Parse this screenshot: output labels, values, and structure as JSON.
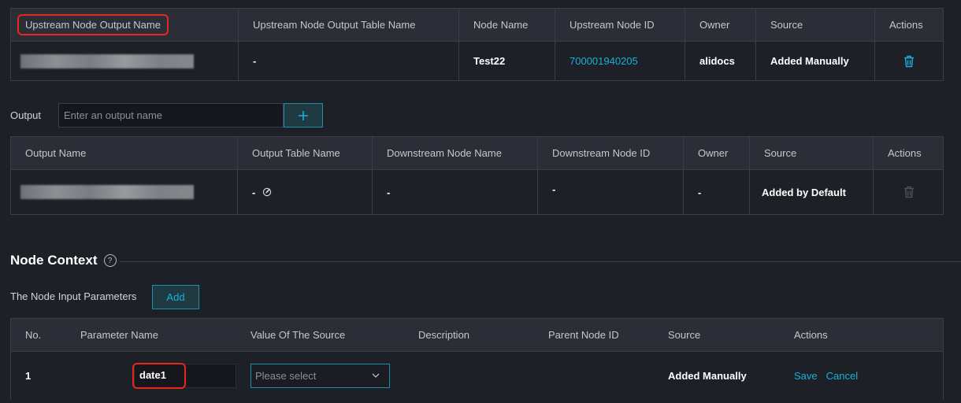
{
  "upstream_table": {
    "headers": [
      "Upstream Node Output Name",
      "Upstream Node Output Table Name",
      "Node Name",
      "Upstream Node ID",
      "Owner",
      "Source",
      "Actions"
    ],
    "row": {
      "table_name": "-",
      "node_name": "Test22",
      "node_id": "700001940205",
      "owner": "alidocs",
      "source": "Added Manually"
    }
  },
  "output": {
    "label": "Output",
    "placeholder": "Enter an output name"
  },
  "output_table": {
    "headers": [
      "Output Name",
      "Output Table Name",
      "Downstream Node Name",
      "Downstream Node ID",
      "Owner",
      "Source",
      "Actions"
    ],
    "row": {
      "table_name": "-",
      "downstream_name": "-",
      "downstream_id": "-",
      "owner": "-",
      "source": "Added by Default"
    }
  },
  "node_context": {
    "title": "Node Context",
    "help_glyph": "?",
    "input_params_label": "The Node Input Parameters",
    "add_label": "Add"
  },
  "params_table": {
    "headers": [
      "No.",
      "Parameter Name",
      "Value Of The Source",
      "Description",
      "Parent Node ID",
      "Source",
      "Actions"
    ],
    "row": {
      "no": "1",
      "param_name": "date1",
      "select_placeholder": "Please select",
      "source": "Added Manually",
      "save": "Save",
      "cancel": "Cancel"
    }
  },
  "colors": {
    "accent": "#19b0d8",
    "highlight": "#e8271b",
    "background": "#1e2027",
    "header": "#2b2e36"
  }
}
